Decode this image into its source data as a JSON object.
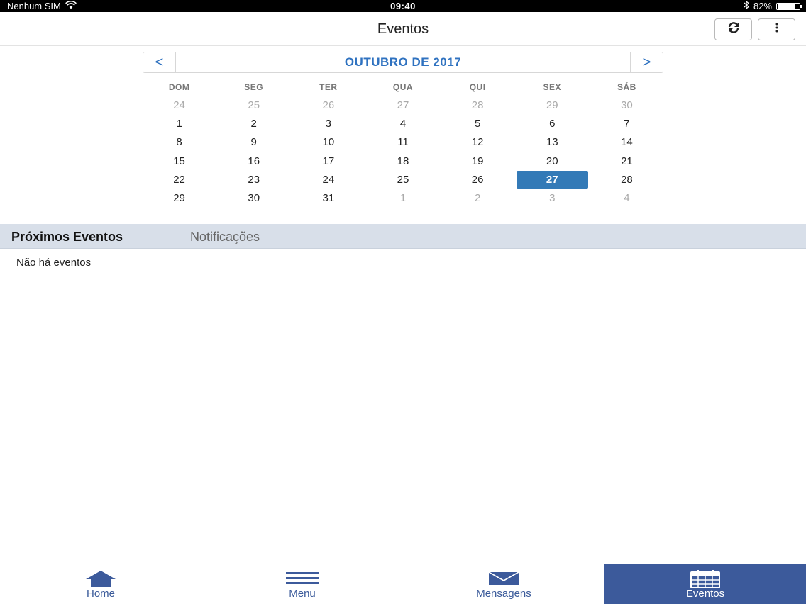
{
  "status_bar": {
    "carrier": "Nenhum SIM",
    "time": "09:40",
    "battery": "82%",
    "battery_level": 0.82
  },
  "header": {
    "title": "Eventos",
    "refresh_icon": "refresh-icon",
    "more_icon": "more-vertical-icon"
  },
  "calendar": {
    "month_label": "OUTUBRO DE 2017",
    "prev": "<",
    "next": ">",
    "weekdays": [
      "DOM",
      "SEG",
      "TER",
      "QUA",
      "QUI",
      "SEX",
      "SÁB"
    ],
    "weeks": [
      [
        "24",
        "25",
        "26",
        "27",
        "28",
        "29",
        "30"
      ],
      [
        "1",
        "2",
        "3",
        "4",
        "5",
        "6",
        "7"
      ],
      [
        "8",
        "9",
        "10",
        "11",
        "12",
        "13",
        "14"
      ],
      [
        "15",
        "16",
        "17",
        "18",
        "19",
        "20",
        "21"
      ],
      [
        "22",
        "23",
        "24",
        "25",
        "26",
        "27",
        "28"
      ],
      [
        "29",
        "30",
        "31",
        "1",
        "2",
        "3",
        "4"
      ]
    ],
    "selected_day": "27",
    "accent_color": "#337ab7"
  },
  "tabs": {
    "upcoming": "Próximos Eventos",
    "notifications": "Notificações"
  },
  "events": {
    "empty_message": "Não há eventos"
  },
  "bottom_nav": [
    {
      "label": "Home",
      "icon": "home-icon"
    },
    {
      "label": "Menu",
      "icon": "menu-icon"
    },
    {
      "label": "Mensagens",
      "icon": "envelope-icon"
    },
    {
      "label": "Eventos",
      "icon": "calendar-icon"
    }
  ]
}
